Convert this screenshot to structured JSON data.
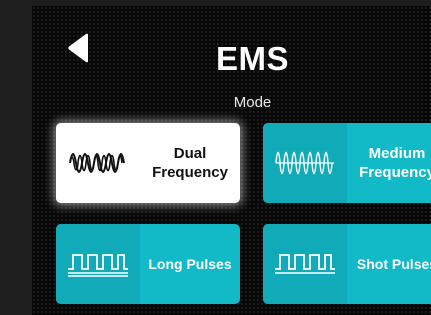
{
  "header": {
    "title": "EMS",
    "subtitle": "Mode"
  },
  "modes": [
    {
      "label_line1": "Dual",
      "label_line2": "Frequency",
      "icon": "dual-frequency-wave-icon",
      "selected": true
    },
    {
      "label_line1": "Medium",
      "label_line2": "Frequency",
      "icon": "medium-frequency-wave-icon",
      "selected": false
    },
    {
      "label": "Long Pulses",
      "icon": "long-pulses-icon",
      "selected": false
    },
    {
      "label": "Shot Pulses",
      "icon": "short-pulses-icon",
      "selected": false
    }
  ],
  "colors": {
    "accent": "#12b9c6",
    "background": "#070707",
    "selected_tile": "#ffffff"
  }
}
